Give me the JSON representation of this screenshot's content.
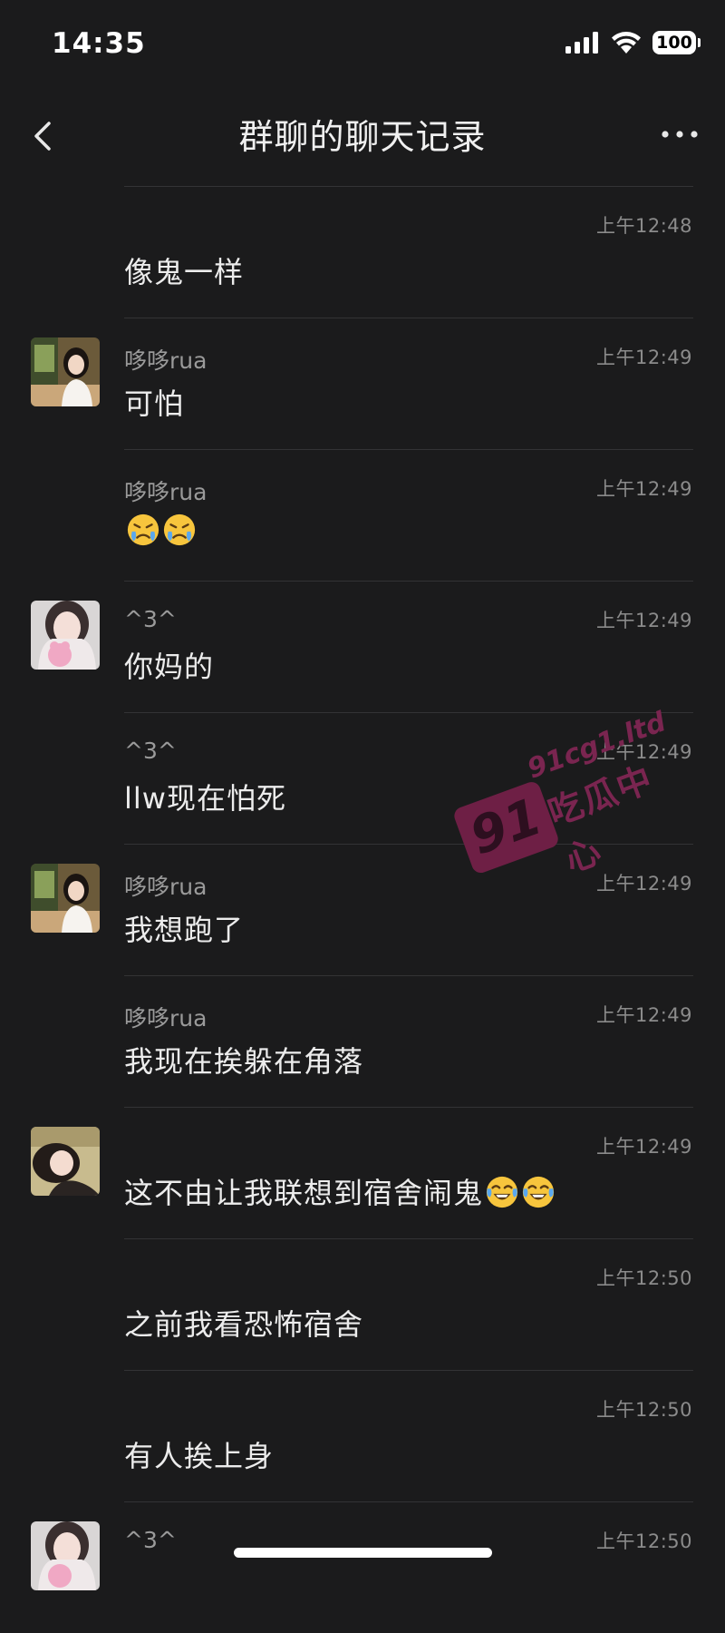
{
  "status_bar": {
    "time": "14:35",
    "battery": "100"
  },
  "nav": {
    "title": "群聊的聊天记录"
  },
  "messages": [
    {
      "sender": "",
      "time": "上午12:48",
      "text": "像鬼一样",
      "avatar": "none"
    },
    {
      "sender": "哆哆rua",
      "time": "上午12:49",
      "text": "可怕",
      "avatar": "girl-cafe"
    },
    {
      "sender": "哆哆rua",
      "time": "上午12:49",
      "text": "",
      "avatar": "none",
      "emojis": [
        "crying-emoji",
        "crying-emoji"
      ]
    },
    {
      "sender": "^3^",
      "time": "上午12:49",
      "text": "你妈的",
      "avatar": "girl-plush"
    },
    {
      "sender": "^3^",
      "time": "上午12:49",
      "text": "llw现在怕死",
      "avatar": "none"
    },
    {
      "sender": "哆哆rua",
      "time": "上午12:49",
      "text": "我想跑了",
      "avatar": "girl-cafe"
    },
    {
      "sender": "哆哆rua",
      "time": "上午12:49",
      "text": "我现在挨躲在角落",
      "avatar": "none"
    },
    {
      "sender": "",
      "time": "上午12:49",
      "text": "这不由让我联想到宿舍闹鬼",
      "avatar": "girl-lying",
      "emojis": [
        "laughing-emoji",
        "laughing-emoji"
      ]
    },
    {
      "sender": "",
      "time": "上午12:50",
      "text": "之前我看恐怖宿舍",
      "avatar": "none"
    },
    {
      "sender": "",
      "time": "上午12:50",
      "text": "有人挨上身",
      "avatar": "none"
    },
    {
      "sender": "^3^",
      "time": "上午12:50",
      "text": "",
      "avatar": "girl-plush"
    }
  ],
  "watermark": {
    "badge": "91",
    "domain": "91cg1.ltd",
    "name": "吃瓜中心"
  }
}
